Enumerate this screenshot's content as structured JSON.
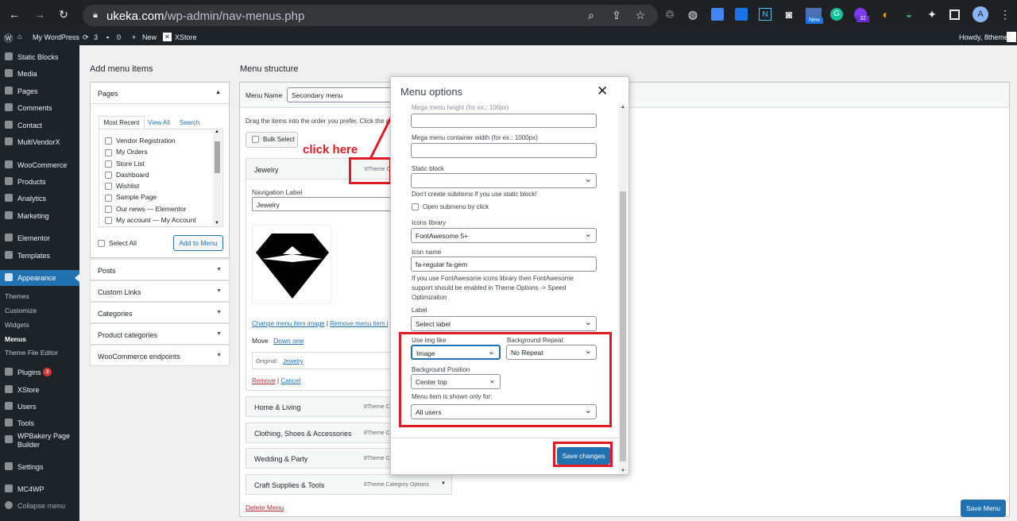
{
  "browser": {
    "url_domain": "ukeka.com",
    "url_path": "/wp-admin/nav-menus.php",
    "ext_badge_new": "New",
    "ext_badge_count": "32",
    "profile_initial": "A"
  },
  "adminbar": {
    "site": "My WordPress",
    "updates": "3",
    "comments": "0",
    "new": "New",
    "xstore": "XStore",
    "howdy": "Howdy, 8theme"
  },
  "sidebar": {
    "items": [
      "Static Blocks",
      "Media",
      "Pages",
      "Comments",
      "Contact",
      "MultiVendorX",
      "WooCommerce",
      "Products",
      "Analytics",
      "Marketing",
      "Elementor",
      "Templates",
      "Appearance"
    ],
    "appearance_sub": [
      "Themes",
      "Customize",
      "Widgets",
      "Menus",
      "Theme File Editor"
    ],
    "items_after": [
      "Plugins",
      "XStore",
      "Users",
      "Tools",
      "WPBakery Page Builder",
      "Settings",
      "MC4WP",
      "Collapse menu"
    ],
    "plugins_badge": "3"
  },
  "left": {
    "title": "Add menu items",
    "pages": "Pages",
    "tabs": [
      "Most Recent",
      "View All",
      "Search"
    ],
    "page_list": [
      "Vendor Registration",
      "My Orders",
      "Store List",
      "Dashboard",
      "Wishlist",
      "Sample Page",
      "Our news — Elementor",
      "My account — My Account"
    ],
    "select_all": "Select All",
    "add_button": "Add to Menu",
    "accordions": [
      "Posts",
      "Custom Links",
      "Categories",
      "Product categories",
      "WooCommerce endpoints"
    ]
  },
  "structure": {
    "title": "Menu structure",
    "menu_name_label": "Menu Name",
    "menu_name_value": "Secondary menu",
    "drag_hint": "Drag the items into the order you prefer. Click the a",
    "bulk_select": "Bulk Select",
    "jewelry": "Jewelry",
    "tag_trunc": "8Theme C",
    "nav_label": "Navigation Label",
    "nav_value": "Jewelry",
    "change_img": "Change menu item image",
    "remove_img": "Remove menu item i",
    "move": "Move",
    "down_one": "Down one",
    "original": "Original:",
    "original_link": "Jewelry",
    "remove": "Remove",
    "cancel": "Cancel",
    "rows": [
      "Home & Living",
      "Clothing, Shoes & Accessories",
      "Wedding & Party",
      "Craft Supplies & Tools"
    ],
    "row_tag": "8Theme C",
    "row_tag_full": "8Theme Category Options",
    "delete_menu": "Delete Menu",
    "save_menu": "Save Menu"
  },
  "annotation": {
    "click_here": "click here"
  },
  "modal": {
    "title": "Menu options",
    "mega_height": "Mega menu height (for ex.: 100px)",
    "mega_width": "Mega menu container width (for ex.: 1000px)",
    "static_block": "Static block",
    "static_note": "Don't create subitems if you use static block!",
    "open_submenu": "Open submenu by click",
    "icons_library": "Icons library",
    "icons_library_value": "FontAwesome 5+",
    "icon_name": "Icon name",
    "icon_name_value": "fa-regular fa-gem",
    "icon_note": "If you use FontAwesome icons library then FontAwesome support should be enabled in Theme Options -> Speed Optimization",
    "label": "Label",
    "label_value": "Select label",
    "use_img": "Use img like",
    "use_img_value": "Image",
    "bg_repeat": "Background Repeat",
    "bg_repeat_value": "No Repeat",
    "bg_position": "Background Position",
    "bg_position_value": "Center top",
    "shown_for": "Menu item is shown only for:",
    "shown_for_value": "All users",
    "save": "Save changes"
  },
  "colors": {
    "wp_blue": "#2271b1",
    "annotation_red": "#e01b24",
    "admin_dark": "#1d2327"
  }
}
